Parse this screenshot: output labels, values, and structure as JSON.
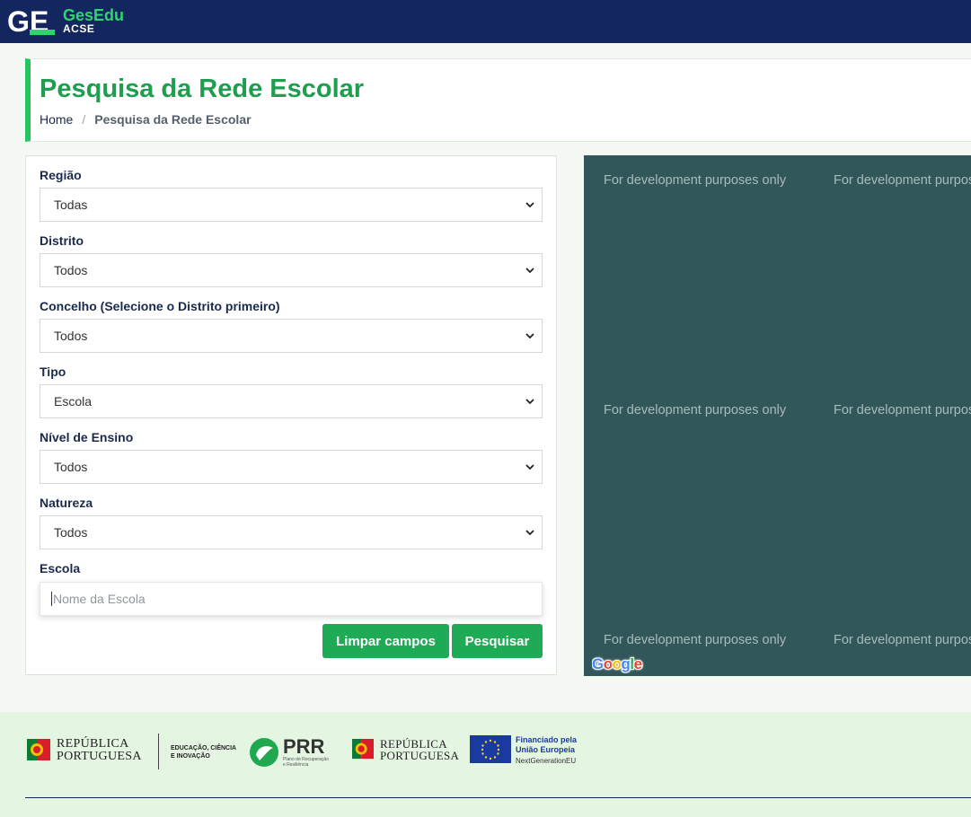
{
  "header": {
    "logo_mark": "GE",
    "logo_name": "GesEdu",
    "logo_sub": "ACSE"
  },
  "page": {
    "title": "Pesquisa da Rede Escolar",
    "breadcrumb": {
      "home": "Home",
      "separator": "/",
      "current": "Pesquisa da Rede Escolar"
    }
  },
  "form": {
    "fields": [
      {
        "label": "Região",
        "value": "Todas"
      },
      {
        "label": "Distrito",
        "value": "Todos"
      },
      {
        "label": "Concelho (Selecione o Distrito primeiro)",
        "value": "Todos"
      },
      {
        "label": "Tipo",
        "value": "Escola"
      },
      {
        "label": "Nível de Ensino",
        "value": "Todos"
      },
      {
        "label": "Natureza",
        "value": "Todos"
      }
    ],
    "escola_label": "Escola",
    "escola_placeholder": "Nome da Escola",
    "clear_button": "Limpar campos",
    "search_button": "Pesquisar"
  },
  "map": {
    "watermark": "For development purposes only",
    "provider": "Google"
  },
  "footer": {
    "republica_line1": "REPÚBLICA",
    "republica_line2": "PORTUGUESA",
    "edu_line1": "EDUCAÇÃO, CIÊNCIA",
    "edu_line2": "E INOVAÇÃO",
    "prr_label": "PRR",
    "prr_sub1": "Plano de Recuperação",
    "prr_sub2": "e Resiliência",
    "eu_line1": "Financiado pela",
    "eu_line2": "União Europeia",
    "eu_line3": "NextGenerationEU"
  },
  "colors": {
    "topbar": "#13265e",
    "accent_green": "#22c55e",
    "button_green": "#1faa55",
    "map_bg": "#32575a",
    "footer_bg": "#e4f5e2"
  }
}
